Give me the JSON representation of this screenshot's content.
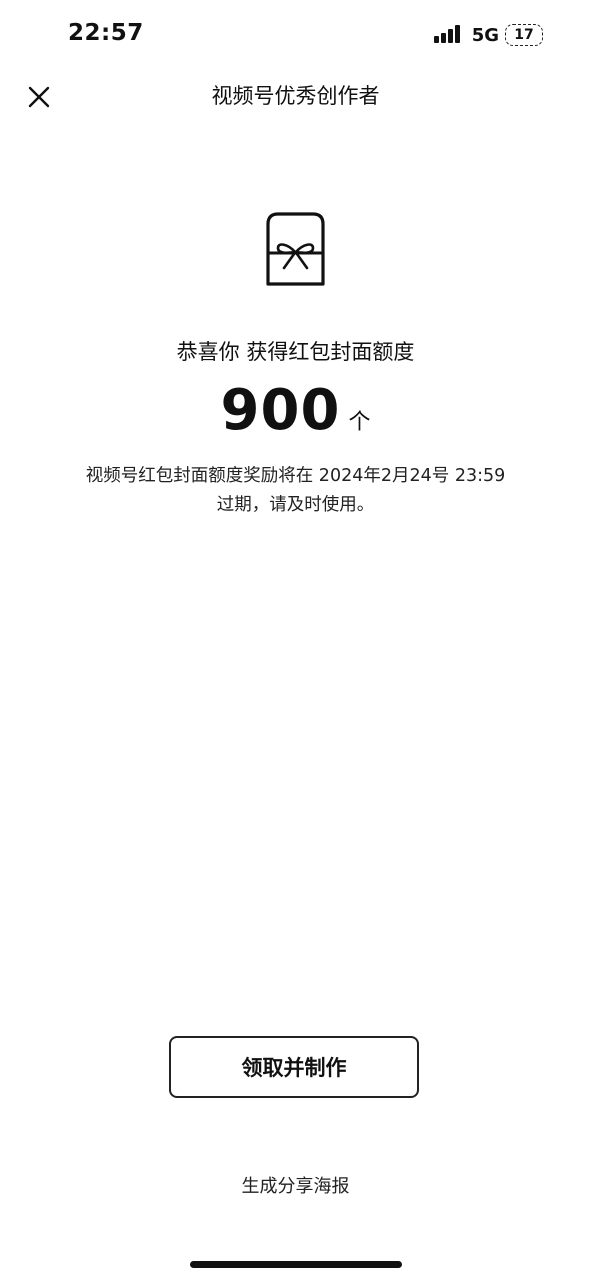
{
  "status_bar": {
    "time": "22:57",
    "network": "5G",
    "battery": "17",
    "signal_bars": 4
  },
  "nav": {
    "close_icon": "close-icon",
    "title": "视频号优秀创作者"
  },
  "hero": {
    "icon": "red-envelope-gift-icon",
    "congrats": "恭喜你 获得红包封面额度",
    "amount": "900",
    "unit": "个",
    "notice_line1": "视频号红包封面额度奖励将在 2024年2月24号 23:59",
    "notice_line2": "过期，请及时使用。"
  },
  "actions": {
    "claim_label": "领取并制作",
    "share_label": "生成分享海报"
  },
  "colors": {
    "background": "#ffffff",
    "text": "#111111"
  }
}
